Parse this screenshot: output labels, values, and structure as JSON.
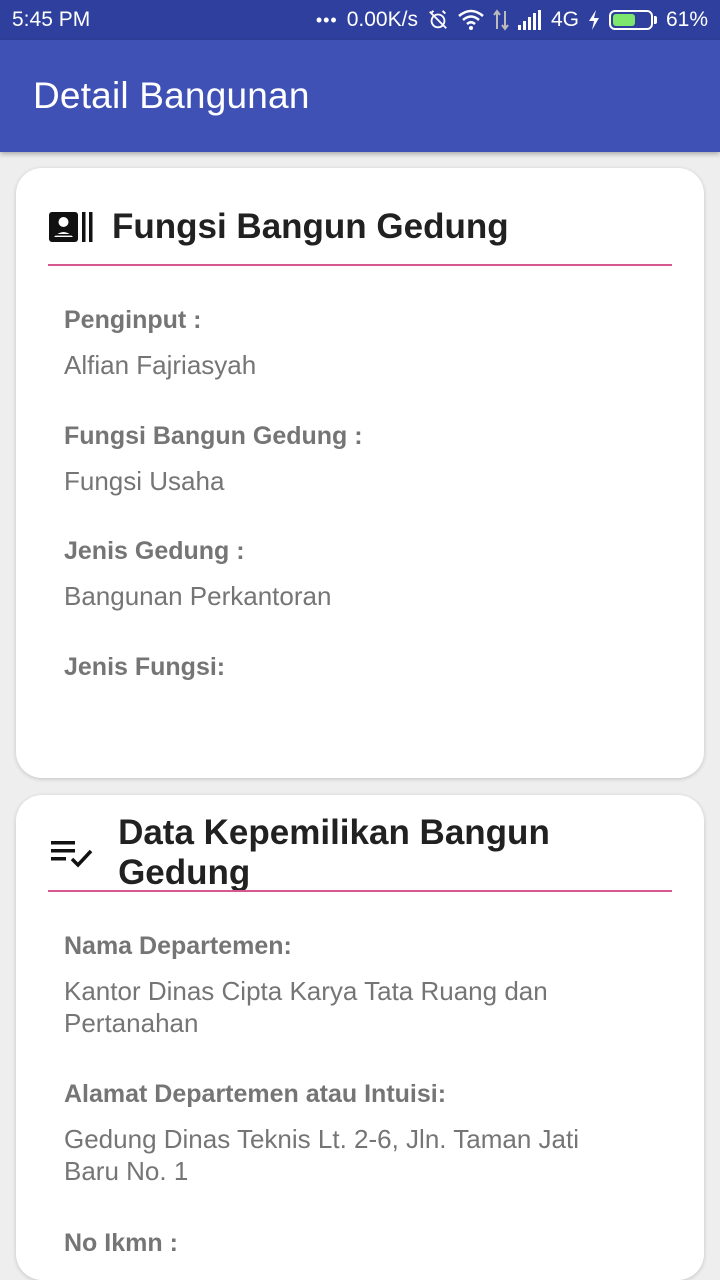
{
  "status_bar": {
    "time": "5:45 PM",
    "dots": "•••",
    "speed": "0.00K/s",
    "network": "4G",
    "battery_level": 0.61,
    "battery": "61%"
  },
  "app_bar": {
    "title": "Detail Bangunan"
  },
  "cards": [
    {
      "title": "Fungsi Bangun Gedung",
      "icon": "contact-card-icon",
      "fields": [
        {
          "label": "Penginput :",
          "value": "Alfian Fajriasyah"
        },
        {
          "label": "Fungsi Bangun Gedung :",
          "value": "Fungsi Usaha"
        },
        {
          "label": "Jenis Gedung :",
          "value": "Bangunan Perkantoran"
        },
        {
          "label": "Jenis Fungsi:",
          "value": ""
        }
      ]
    },
    {
      "title": "Data Kepemilikan Bangun Gedung",
      "icon": "playlist-check-icon",
      "fields": [
        {
          "label": "Nama Departemen:",
          "value_line1": "Kantor Dinas Cipta Karya Tata Ruang dan",
          "value_line2": "Pertanahan"
        },
        {
          "label": "Alamat Departemen atau Intuisi:",
          "value_line1": "Gedung Dinas Teknis Lt. 2-6, Jln. Taman Jati",
          "value_line2": "Baru No. 1"
        },
        {
          "label": "No Ikmn :"
        }
      ]
    }
  ],
  "colors": {
    "status_bar": "#2f3f9e",
    "app_bar": "#3f51b5",
    "divider": "#d6588e",
    "background": "#eeeeee"
  }
}
